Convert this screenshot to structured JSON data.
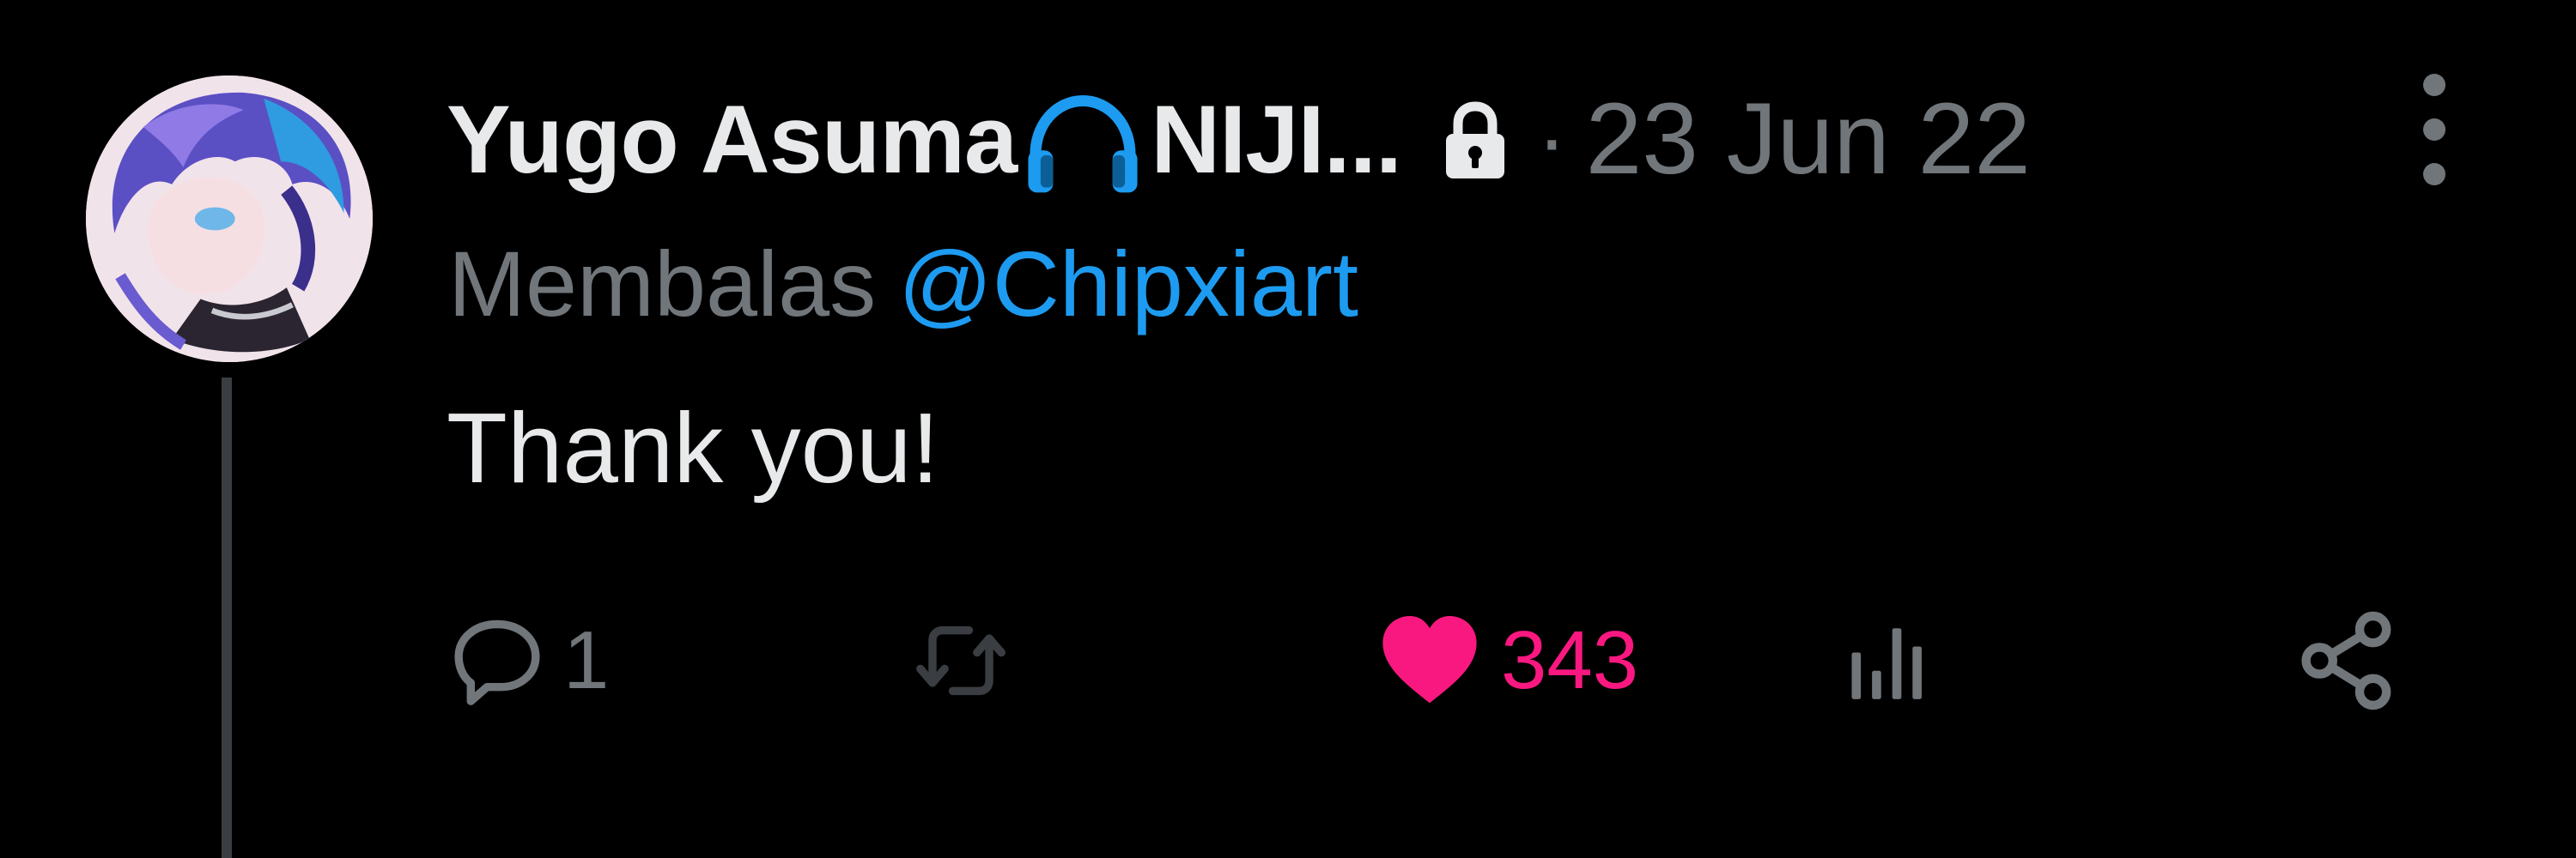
{
  "tweet": {
    "author": {
      "display_name": "Yugo Asuma",
      "name_suffix": "NIJI...",
      "verified_icon": "headphones-icon",
      "protected_icon": "lock-icon"
    },
    "separator": "·",
    "timestamp": "23 Jun 22",
    "reply_prefix": "Membalas",
    "reply_mention": "@Chipxiart",
    "text": "Thank you!",
    "actions": {
      "reply_count": "1",
      "like_count": "343"
    }
  },
  "colors": {
    "background": "#000000",
    "primary_text": "#e7e9ea",
    "secondary_text": "#71767b",
    "link": "#1d9bf0",
    "like": "#f91880",
    "headphones": "#1d9bf0"
  }
}
